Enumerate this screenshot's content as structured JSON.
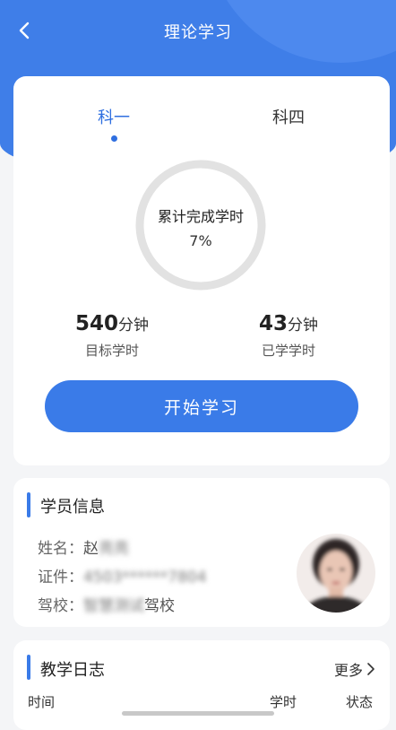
{
  "header": {
    "title": "理论学习",
    "back_icon": "chevron-left-icon"
  },
  "tabs": [
    {
      "label": "科一",
      "active": true
    },
    {
      "label": "科四",
      "active": false
    }
  ],
  "progress": {
    "label": "累计完成学时",
    "percent_text": "7%",
    "percent": 7
  },
  "stats": {
    "target": {
      "value": "540",
      "unit": "分钟",
      "caption": "目标学时"
    },
    "learned": {
      "value": "43",
      "unit": "分钟",
      "caption": "已学学时"
    }
  },
  "start_button": {
    "label": "开始学习"
  },
  "student": {
    "section_title": "学员信息",
    "name_label": "姓名：",
    "name_value_prefix": "赵",
    "name_value_blurred": "亮亮",
    "id_label": "证件：",
    "id_value": "4503******7804",
    "school_label": "驾校：",
    "school_value_blurred": "智慧测试",
    "school_value_suffix": "驾校"
  },
  "log": {
    "section_title": "教学日志",
    "more_label": "更多",
    "columns": [
      "时间",
      "学时",
      "状态"
    ]
  },
  "colors": {
    "primary": "#3a7be8",
    "header_bg": "#3f7ee8",
    "ring_track": "#e2e2e2",
    "page_bg": "#f4f5f7"
  }
}
